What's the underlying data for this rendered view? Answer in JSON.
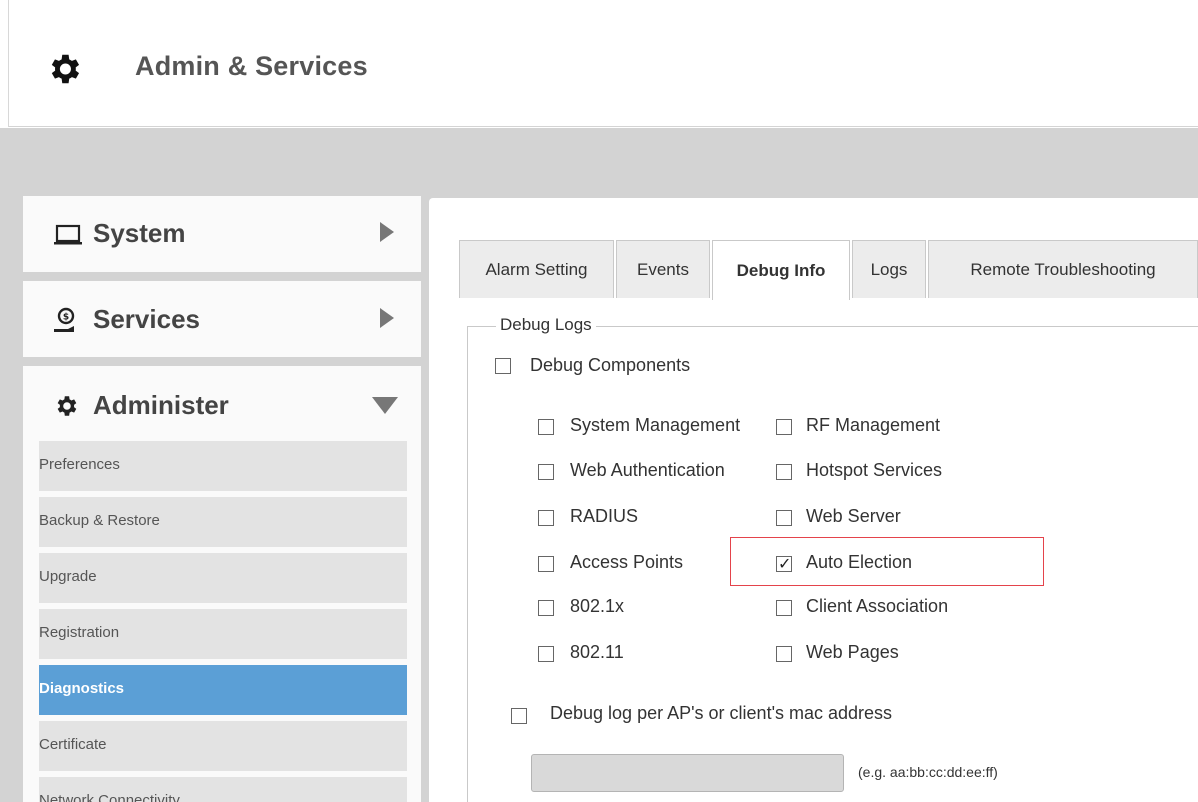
{
  "header": {
    "title": "Admin & Services",
    "icon": "gear-icon"
  },
  "nav": {
    "system": {
      "label": "System",
      "icon": "laptop-icon"
    },
    "services": {
      "label": "Services",
      "icon": "services-icon"
    },
    "administer": {
      "label": "Administer",
      "icon": "gear-icon"
    }
  },
  "submenu": [
    {
      "label": "Preferences"
    },
    {
      "label": "Backup & Restore"
    },
    {
      "label": "Upgrade"
    },
    {
      "label": "Registration"
    },
    {
      "label": "Diagnostics",
      "active": true
    },
    {
      "label": "Certificate"
    },
    {
      "label": "Network Connectivity"
    }
  ],
  "tabs": [
    {
      "label": "Alarm Setting"
    },
    {
      "label": "Events"
    },
    {
      "label": "Debug Info",
      "active": true
    },
    {
      "label": "Logs"
    },
    {
      "label": "Remote Troubleshooting"
    }
  ],
  "debug": {
    "legend": "Debug Logs",
    "components_label": "Debug Components",
    "left_column": [
      {
        "label": "System Management",
        "checked": false
      },
      {
        "label": "Web Authentication",
        "checked": false
      },
      {
        "label": "RADIUS",
        "checked": false
      },
      {
        "label": "Access Points",
        "checked": false
      },
      {
        "label": "802.1x",
        "checked": false
      },
      {
        "label": "802.11",
        "checked": false
      }
    ],
    "right_column": [
      {
        "label": "RF Management",
        "checked": false
      },
      {
        "label": "Hotspot Services",
        "checked": false
      },
      {
        "label": "Web Server",
        "checked": false
      },
      {
        "label": "Auto Election",
        "checked": true
      },
      {
        "label": "Client Association",
        "checked": false
      },
      {
        "label": "Web Pages",
        "checked": false
      }
    ],
    "mac_label": "Debug log per AP's or client's mac address",
    "mac_value": "",
    "mac_hint": "(e.g. aa:bb:cc:dd:ee:ff)"
  },
  "colors": {
    "active": "#5b9fd6",
    "highlight": "#e4434b"
  }
}
